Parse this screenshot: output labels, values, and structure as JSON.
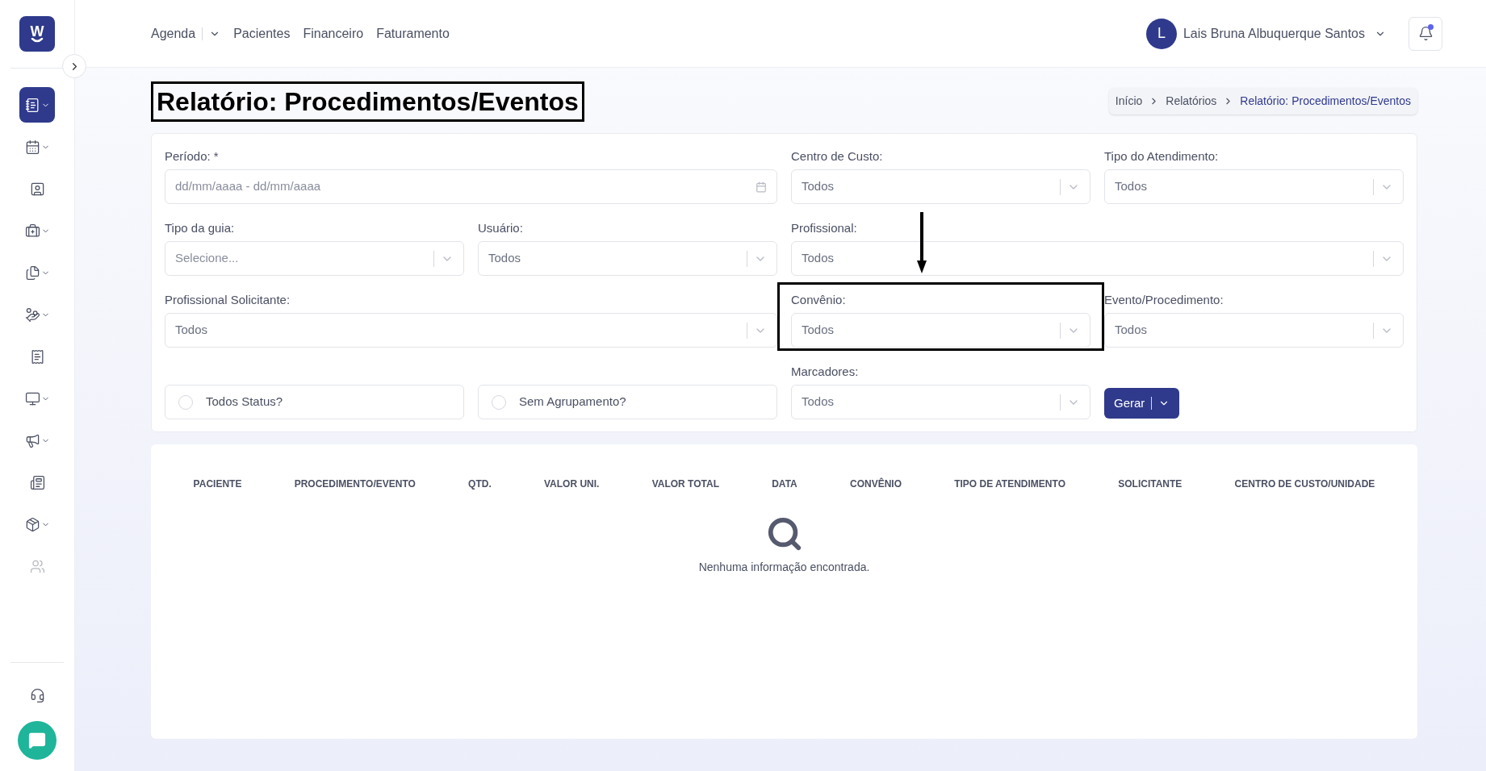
{
  "logo": {
    "letter": "W"
  },
  "sidebar": {
    "items": [
      {
        "selected": true,
        "has_submenu": true,
        "disabled": false
      },
      {
        "selected": false,
        "has_submenu": true,
        "disabled": false
      },
      {
        "selected": false,
        "has_submenu": false,
        "disabled": false
      },
      {
        "selected": false,
        "has_submenu": true,
        "disabled": false
      },
      {
        "selected": false,
        "has_submenu": true,
        "disabled": false
      },
      {
        "selected": false,
        "has_submenu": true,
        "disabled": false
      },
      {
        "selected": false,
        "has_submenu": false,
        "disabled": false
      },
      {
        "selected": false,
        "has_submenu": true,
        "disabled": false
      },
      {
        "selected": false,
        "has_submenu": true,
        "disabled": false
      },
      {
        "selected": false,
        "has_submenu": false,
        "disabled": false
      },
      {
        "selected": false,
        "has_submenu": true,
        "disabled": false
      },
      {
        "selected": false,
        "has_submenu": false,
        "disabled": true
      }
    ]
  },
  "top_nav": [
    {
      "label": "Agenda",
      "dropdown": true
    },
    {
      "label": "Pacientes",
      "dropdown": false
    },
    {
      "label": "Financeiro",
      "dropdown": false
    },
    {
      "label": "Faturamento",
      "dropdown": false
    }
  ],
  "user": {
    "initial": "L",
    "name": "Lais Bruna Albuquerque Santos"
  },
  "notifications": {
    "unread": true
  },
  "page_title": {
    "text": "Relatório: Procedimentos/Eventos",
    "annotated": true
  },
  "breadcrumb": [
    {
      "label": "Início",
      "current": false
    },
    {
      "label": "Relatórios",
      "current": false
    },
    {
      "label": "Relatório: Procedimentos/Eventos",
      "current": true
    }
  ],
  "filters": [
    {
      "kind": "date",
      "label": "Período: *",
      "placeholder": "dd/mm/aaaa - dd/mm/aaaa",
      "annotated": false
    },
    {
      "kind": "select",
      "label": "Centro de Custo:",
      "value": "Todos",
      "annotated": false
    },
    {
      "kind": "select",
      "label": "Tipo do Atendimento:",
      "value": "Todos",
      "annotated": false
    },
    {
      "kind": "select",
      "label": "Tipo da guia:",
      "placeholder": "Selecione...",
      "annotated": false
    },
    {
      "kind": "select",
      "label": "Usuário:",
      "value": "Todos",
      "annotated": false
    },
    {
      "kind": "select",
      "label": "Profissional:",
      "value": "Todos",
      "annotated": false
    },
    {
      "kind": "select",
      "label": "Profissional Solicitante:",
      "value": "Todos",
      "annotated": false
    },
    {
      "kind": "select",
      "label": "Convênio:",
      "value": "Todos",
      "annotated": true
    },
    {
      "kind": "select",
      "label": "Evento/Procedimento:",
      "value": "Todos",
      "annotated": false
    },
    {
      "kind": "checkbox",
      "label": "Todos Status?",
      "checked": false
    },
    {
      "kind": "checkbox",
      "label": "Sem Agrupamento?",
      "checked": false
    },
    {
      "kind": "select",
      "label": "Marcadores:",
      "value": "Todos",
      "annotated": false
    },
    {
      "kind": "button",
      "label": "Gerar",
      "dropdown": true
    }
  ],
  "table": {
    "columns": [
      "PACIENTE",
      "PROCEDIMENTO/EVENTO",
      "QTD.",
      "VALOR UNI.",
      "VALOR TOTAL",
      "DATA",
      "CONVÊNIO",
      "TIPO DE ATENDIMENTO",
      "SOLICITANTE",
      "CENTRO DE CUSTO/UNIDADE"
    ],
    "empty_message": "Nenhuma informação encontrada."
  }
}
